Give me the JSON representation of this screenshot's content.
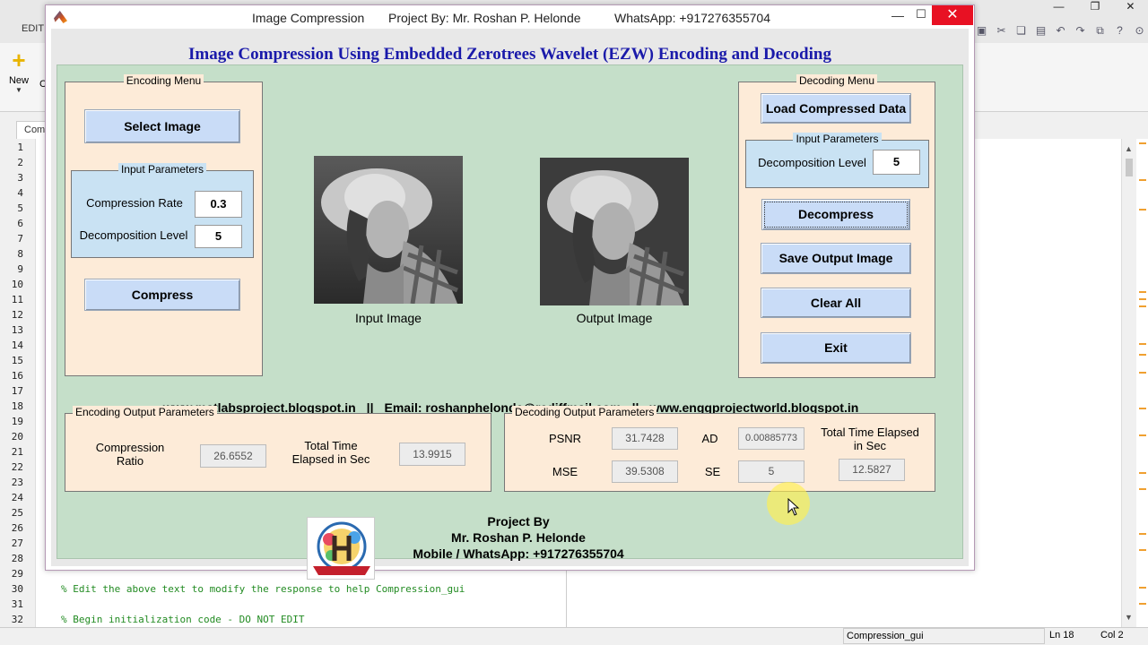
{
  "background_editor": {
    "tab_label": "EDIT",
    "new_label": "New",
    "new_c_label": "C",
    "doc_tab": "Com",
    "line_numbers": [
      1,
      2,
      3,
      4,
      5,
      6,
      7,
      8,
      9,
      10,
      11,
      12,
      13,
      14,
      15,
      16,
      17,
      18,
      19,
      20,
      21,
      22,
      23,
      24,
      25,
      26,
      27,
      28,
      29,
      30,
      31,
      32
    ],
    "code_lines": [
      {
        "line": 30,
        "text": "% Edit the above text to modify the response to help Compression_gui"
      },
      {
        "line": 32,
        "text": "% Begin initialization code - DO NOT EDIT"
      }
    ],
    "status": {
      "file": "Compression_gui",
      "ln": "Ln  18",
      "col": "Col  2"
    }
  },
  "window": {
    "title_app": "Image Compression",
    "title_project": "Project By: Mr. Roshan P. Helonde",
    "title_whatsapp": "WhatsApp: +917276355704"
  },
  "heading": "Image Compression Using Embedded Zerotrees Wavelet (EZW) Encoding and Decoding",
  "encoding_menu": {
    "title": "Encoding Menu",
    "select_image": "Select Image",
    "input_params_title": "Input Parameters",
    "compression_rate_label": "Compression Rate",
    "compression_rate_value": "0.3",
    "decomposition_level_label": "Decomposition Level",
    "decomposition_level_value": "5",
    "compress": "Compress"
  },
  "images": {
    "input_label": "Input Image",
    "output_label": "Output Image"
  },
  "decoding_menu": {
    "title": "Decoding Menu",
    "load_compressed": "Load Compressed Data",
    "input_params_title": "Input Parameters",
    "decomposition_level_label": "Decomposition Level",
    "decomposition_level_value": "5",
    "decompress": "Decompress",
    "save_output": "Save Output Image",
    "clear_all": "Clear All",
    "exit": "Exit"
  },
  "links": {
    "blog1": "www.matlabsproject.blogspot.in",
    "sep": "||",
    "email": "Email: roshanphelonde@rediffmail.com",
    "blog2": "www.enggprojectworld.blogspot.in"
  },
  "encoding_output": {
    "title": "Encoding Output Parameters",
    "compression_ratio_label": "Compression Ratio",
    "compression_ratio_value": "26.6552",
    "time_label": "Total Time Elapsed in Sec",
    "time_value": "13.9915"
  },
  "decoding_output": {
    "title": "Decoding Output Parameters",
    "psnr_label": "PSNR",
    "psnr_value": "31.7428",
    "ad_label": "AD",
    "ad_value": "0.00885773",
    "time_label": "Total Time Elapsed in Sec",
    "mse_label": "MSE",
    "mse_value": "39.5308",
    "se_label": "SE",
    "se_value": "5",
    "time_value": "12.5827"
  },
  "footer": {
    "project_by": "Project By",
    "name": "Mr. Roshan P. Helonde",
    "mobile": "Mobile / WhatsApp: +917276355704"
  },
  "colors": {
    "panel_bg": "#fdebd8",
    "green_bg": "#c5dfc9",
    "button_bg": "#c9dcf7",
    "heading": "#1a1aaa",
    "close": "#e81123"
  }
}
